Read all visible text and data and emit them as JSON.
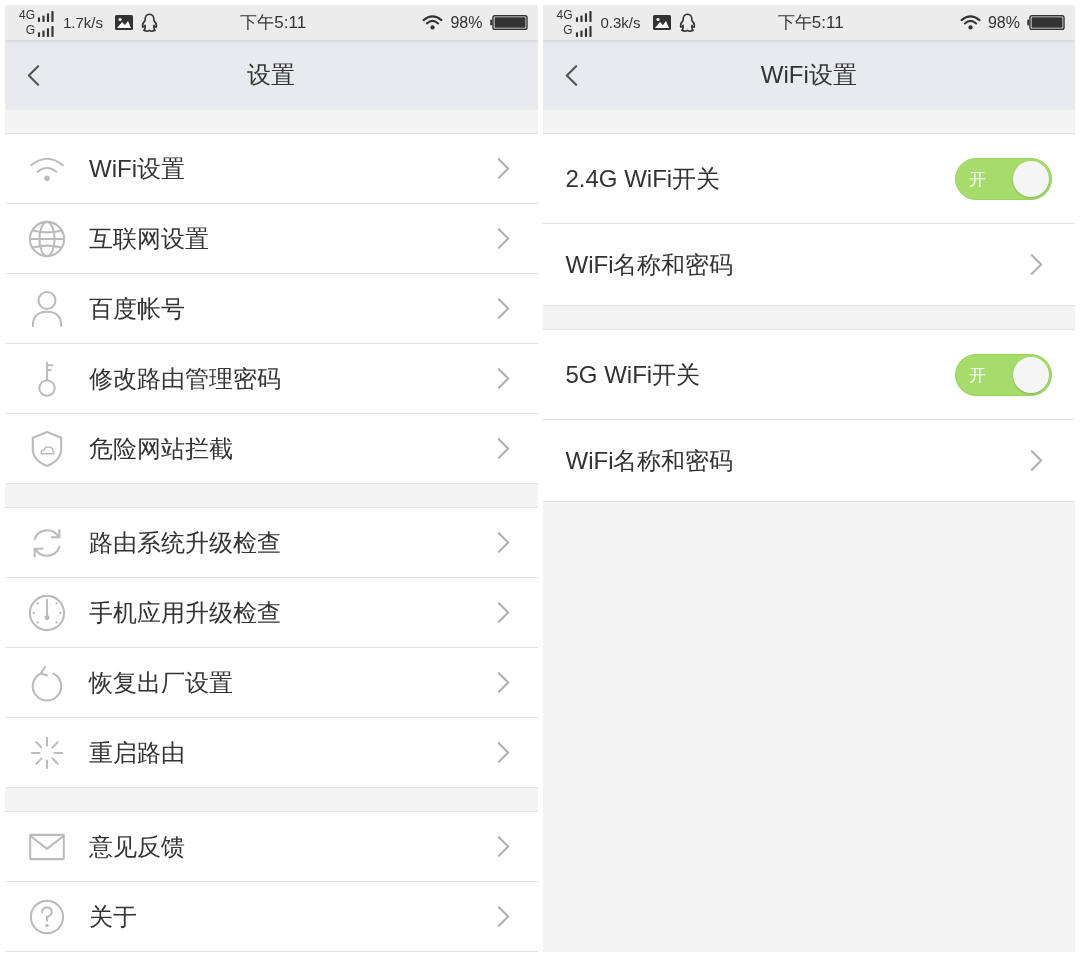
{
  "screens": [
    {
      "status_bar": {
        "network": "4G",
        "network_2": "G",
        "speed": "1.7k/s",
        "time": "下午5:11",
        "battery": "98%"
      },
      "header": {
        "title": "设置"
      },
      "groups": [
        {
          "items": [
            {
              "kind": "entry",
              "label": "WiFi设置"
            },
            {
              "kind": "entry",
              "label": "互联网设置"
            },
            {
              "kind": "entry",
              "label": "百度帐号"
            },
            {
              "kind": "entry",
              "label": "修改路由管理密码"
            },
            {
              "kind": "entry",
              "label": "危险网站拦截"
            }
          ]
        },
        {
          "items": [
            {
              "kind": "entry",
              "label": "路由系统升级检查"
            },
            {
              "kind": "entry",
              "label": "手机应用升级检查"
            },
            {
              "kind": "entry",
              "label": "恢复出厂设置"
            },
            {
              "kind": "entry",
              "label": "重启路由"
            }
          ]
        },
        {
          "items": [
            {
              "kind": "entry",
              "label": "意见反馈"
            },
            {
              "kind": "entry",
              "label": "关于"
            }
          ]
        }
      ]
    },
    {
      "status_bar": {
        "network": "4G",
        "network_2": "G",
        "speed": "0.3k/s",
        "time": "下午5:11",
        "battery": "98%"
      },
      "header": {
        "title": "WiFi设置"
      },
      "groups": [
        {
          "items": [
            {
              "kind": "toggle",
              "label": "2.4G WiFi开关",
              "on": true,
              "switch_text": "开"
            },
            {
              "kind": "link",
              "label": "WiFi名称和密码"
            }
          ]
        },
        {
          "items": [
            {
              "kind": "toggle",
              "label": "5G WiFi开关",
              "on": true,
              "switch_text": "开"
            },
            {
              "kind": "link",
              "label": "WiFi名称和密码"
            }
          ]
        }
      ]
    }
  ]
}
